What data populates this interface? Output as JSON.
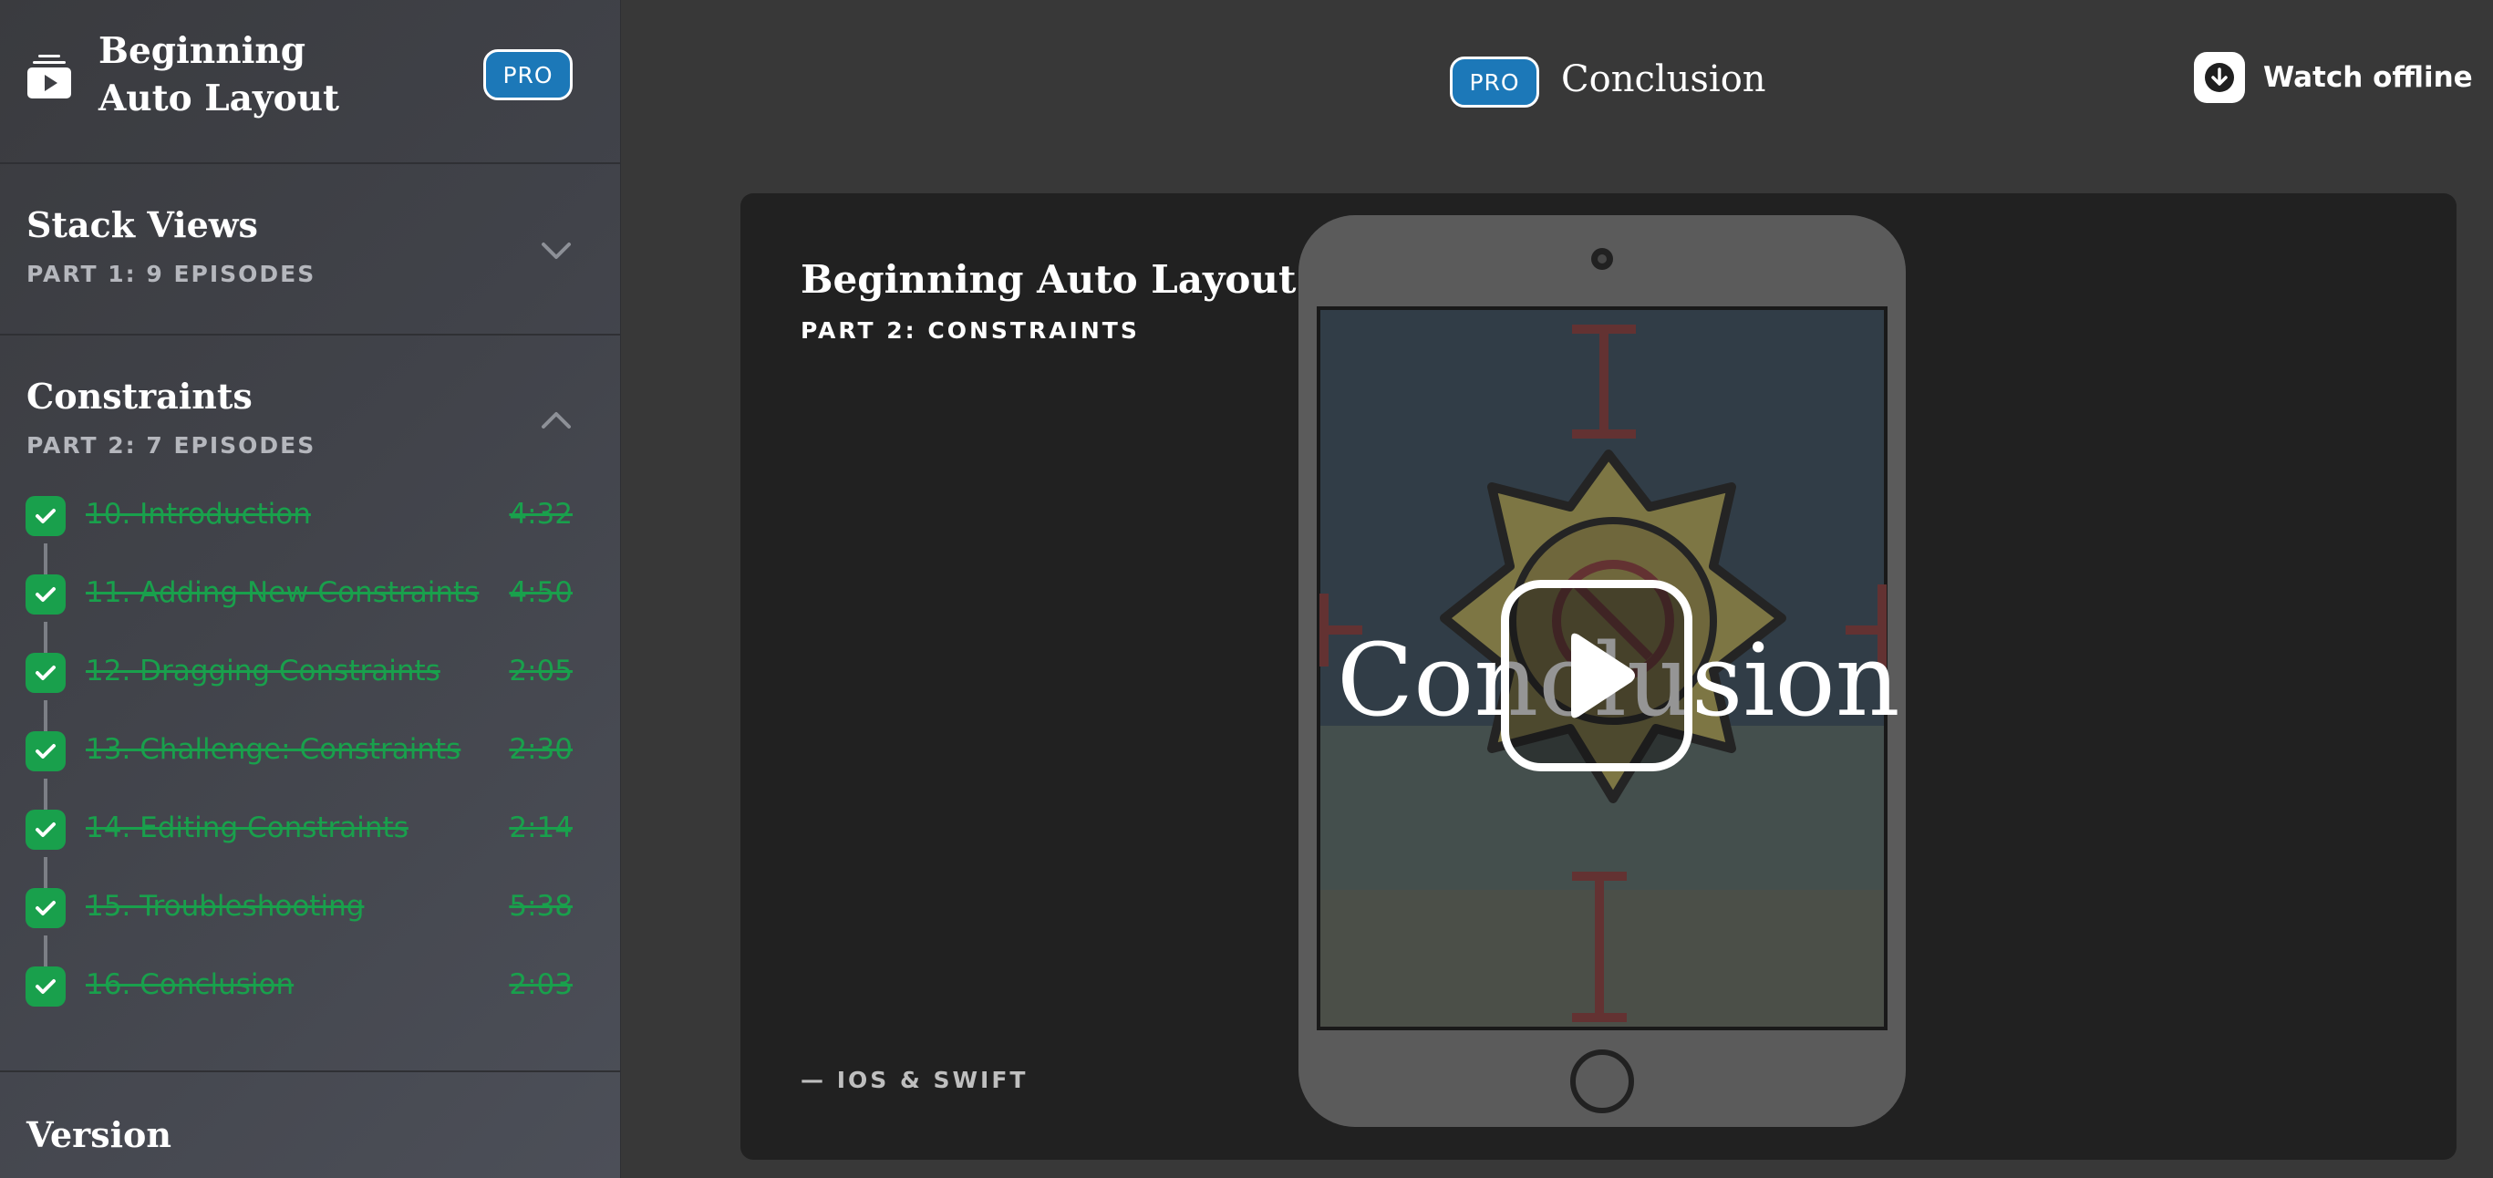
{
  "sidebar": {
    "course_title": "Beginning Auto Layout",
    "pro_badge": "PRO",
    "sections": [
      {
        "title": "Stack Views",
        "subtitle": "PART 1: 9 EPISODES",
        "expanded": false
      },
      {
        "title": "Constraints",
        "subtitle": "PART 2: 7 EPISODES",
        "expanded": true
      },
      {
        "title": "Version"
      }
    ],
    "episodes": [
      {
        "title": "10. Introduction",
        "duration": "4:32",
        "completed": true
      },
      {
        "title": "11. Adding New Constraints",
        "duration": "4:50",
        "completed": true
      },
      {
        "title": "12. Dragging Constraints",
        "duration": "2:05",
        "completed": true
      },
      {
        "title": "13. Challenge: Constraints",
        "duration": "2:30",
        "completed": true
      },
      {
        "title": "14. Editing Constraints",
        "duration": "2:14",
        "completed": true
      },
      {
        "title": "15. Troubleshooting",
        "duration": "5:38",
        "completed": true
      },
      {
        "title": "16. Conclusion",
        "duration": "2:03",
        "completed": true
      }
    ]
  },
  "header": {
    "pro_badge": "PRO",
    "episode_title": "Conclusion",
    "watch_offline": "Watch offline"
  },
  "player": {
    "course_title": "Beginning Auto Layout",
    "part": "PART 2: CONSTRAINTS",
    "brand": "— IOS & SWIFT",
    "overlay_title": "Conclusion"
  },
  "colors": {
    "accent_blue": "#1c78b8",
    "complete_green": "#19a04c",
    "background": "#383838",
    "player_bg": "#212121"
  },
  "icons": {
    "course": "video-library-icon",
    "collapsed": "chevron-down-icon",
    "expanded": "chevron-up-icon",
    "completed": "checkmark-icon",
    "download": "download-icon",
    "play": "play-icon"
  }
}
